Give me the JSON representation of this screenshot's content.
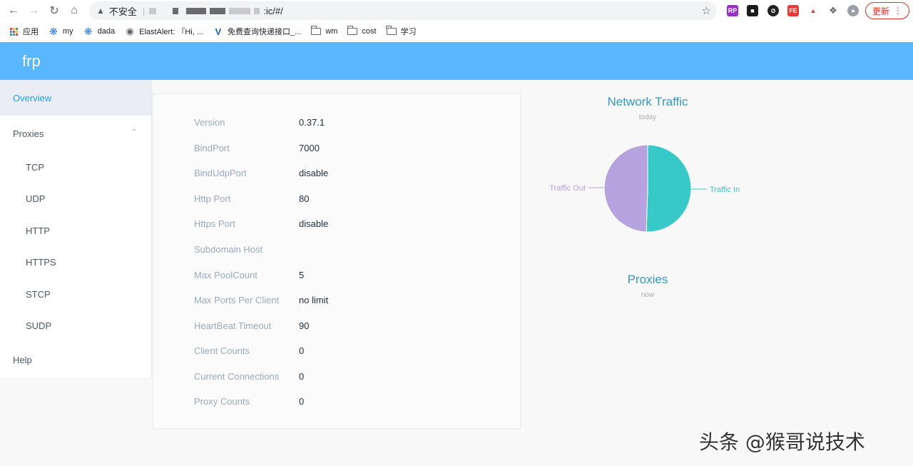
{
  "browser": {
    "security_label": "不安全",
    "url_suffix": ":ic/#/",
    "update_label": "更新",
    "bookmarks": [
      {
        "icon": "apps-grid-icon",
        "label": "应用"
      },
      {
        "icon": "spiral-icon",
        "label": "my"
      },
      {
        "icon": "spiral-icon",
        "label": "dada"
      },
      {
        "icon": "globe-icon",
        "label": "ElastAlert: 『Hi, ..."
      },
      {
        "icon": "v-logo-icon",
        "label": "免费查询快递接口_..."
      },
      {
        "icon": "folder-icon",
        "label": "wm"
      },
      {
        "icon": "folder-icon",
        "label": "cost"
      },
      {
        "icon": "folder-icon",
        "label": "学习"
      }
    ]
  },
  "app": {
    "brand": "frp"
  },
  "sidebar": {
    "overview": "Overview",
    "proxies": "Proxies",
    "proxy_types": [
      "TCP",
      "UDP",
      "HTTP",
      "HTTPS",
      "STCP",
      "SUDP"
    ],
    "help": "Help"
  },
  "overview": {
    "rows": [
      {
        "label": "Version",
        "value": "0.37.1"
      },
      {
        "label": "BindPort",
        "value": "7000"
      },
      {
        "label": "BindUdpPort",
        "value": "disable"
      },
      {
        "label": "Http Port",
        "value": "80"
      },
      {
        "label": "Https Port",
        "value": "disable"
      },
      {
        "label": "Subdomain Host",
        "value": ""
      },
      {
        "label": "Max PoolCount",
        "value": "5"
      },
      {
        "label": "Max Ports Per Client",
        "value": "no limit"
      },
      {
        "label": "HeartBeat Timeout",
        "value": "90"
      },
      {
        "label": "Client Counts",
        "value": "0"
      },
      {
        "label": "Current Connections",
        "value": "0"
      },
      {
        "label": "Proxy Counts",
        "value": "0"
      }
    ]
  },
  "traffic_chart": {
    "title": "Network Traffic",
    "subtitle": "today"
  },
  "proxies_chart": {
    "title": "Proxies",
    "subtitle": "now"
  },
  "watermark": "头条 @猴哥说技术",
  "chart_data": {
    "type": "pie",
    "title": "Network Traffic",
    "subtitle": "today",
    "categories": [
      "Traffic In",
      "Traffic Out"
    ],
    "values": [
      50.5,
      49.5
    ],
    "colors": [
      "#37c9c7",
      "#b6a2de"
    ]
  }
}
